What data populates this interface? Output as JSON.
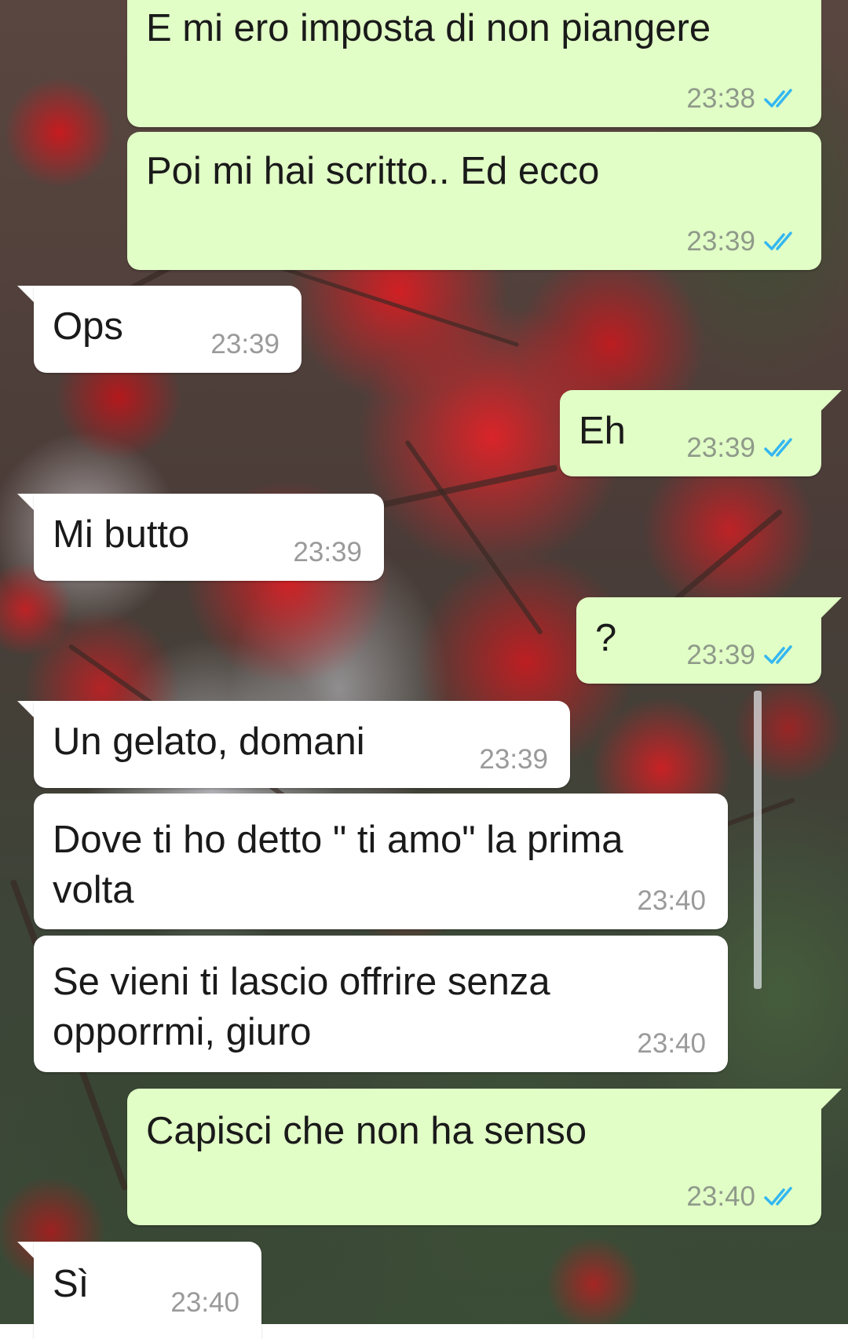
{
  "messages": [
    {
      "direction": "out",
      "text": "E mi ero imposta di non piangere",
      "time": "23:38",
      "status": "read"
    },
    {
      "direction": "out",
      "text": "Poi mi hai scritto.. Ed ecco",
      "time": "23:39",
      "status": "read"
    },
    {
      "direction": "in",
      "text": "Ops",
      "time": "23:39"
    },
    {
      "direction": "out",
      "text": "Eh",
      "time": "23:39",
      "status": "read"
    },
    {
      "direction": "in",
      "text": "Mi butto",
      "time": "23:39"
    },
    {
      "direction": "out",
      "text": "?",
      "time": "23:39",
      "status": "read"
    },
    {
      "direction": "in",
      "text": "Un gelato, domani",
      "time": "23:39"
    },
    {
      "direction": "in",
      "text": "Dove ti ho detto \" ti amo\" la prima\nvolta",
      "time": "23:40"
    },
    {
      "direction": "in",
      "text": "Se vieni ti lascio offrire senza\nopporrmi, giuro",
      "time": "23:40"
    },
    {
      "direction": "out",
      "text": "Capisci che non ha senso",
      "time": "23:40",
      "status": "read"
    },
    {
      "direction": "in",
      "text": "Sì",
      "time": "23:40"
    }
  ],
  "colors": {
    "outgoing_bubble": "#e1fec6",
    "incoming_bubble": "#ffffff",
    "read_ticks": "#34b7f1",
    "timestamp": "#8f9a8a"
  },
  "icons": {
    "read_receipt": "double-check-icon"
  }
}
